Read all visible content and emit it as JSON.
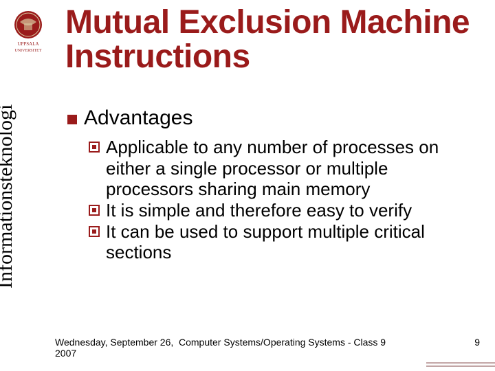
{
  "sidebar_label": "Informationsteknologi",
  "logo": {
    "top_text": "UPPSALA",
    "bottom_text": "UNIVERSITET"
  },
  "title": "Mutual Exclusion Machine Instructions",
  "bullet": {
    "label": "Advantages"
  },
  "sublist": [
    "Applicable to any number of processes on either a single processor or multiple processors sharing main memory",
    "It is simple and therefore easy to verify",
    "It can be used to support multiple critical sections"
  ],
  "footer": {
    "date": "Wednesday, September 26, 2007",
    "center": "Computer Systems/Operating Systems - Class 9",
    "page": "9"
  }
}
